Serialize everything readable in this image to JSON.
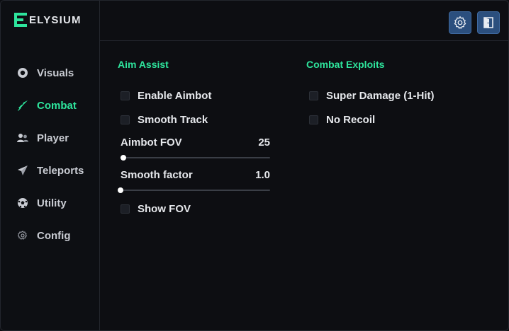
{
  "app": {
    "name": "ELYSIUM",
    "accent_color": "#2ee59d"
  },
  "sidebar": {
    "items": [
      {
        "label": "Visuals",
        "icon": "eye-icon",
        "active": false
      },
      {
        "label": "Combat",
        "icon": "sword-icon",
        "active": true
      },
      {
        "label": "Player",
        "icon": "users-icon",
        "active": false
      },
      {
        "label": "Teleports",
        "icon": "paper-plane-icon",
        "active": false
      },
      {
        "label": "Utility",
        "icon": "football-icon",
        "active": false
      },
      {
        "label": "Config",
        "icon": "gear-icon",
        "active": false
      }
    ]
  },
  "topbar": {
    "buttons": [
      {
        "icon": "gear-icon",
        "action": "settings"
      },
      {
        "icon": "exit-door-icon",
        "action": "exit"
      }
    ],
    "button_color": "#2b4f7e"
  },
  "aim_assist": {
    "title": "Aim Assist",
    "enable_aimbot": {
      "label": "Enable Aimbot",
      "checked": false
    },
    "smooth_track": {
      "label": "Smooth Track",
      "checked": false
    },
    "aimbot_fov": {
      "label": "Aimbot FOV",
      "value": "25",
      "fill_fraction": 0.02
    },
    "smooth_factor": {
      "label": "Smooth factor",
      "value": "1.0",
      "fill_fraction": 0.0
    },
    "show_fov": {
      "label": "Show FOV",
      "checked": false
    }
  },
  "combat_exploits": {
    "title": "Combat Exploits",
    "super_damage": {
      "label": "Super Damage (1-Hit)",
      "checked": false
    },
    "no_recoil": {
      "label": "No Recoil",
      "checked": false
    }
  }
}
